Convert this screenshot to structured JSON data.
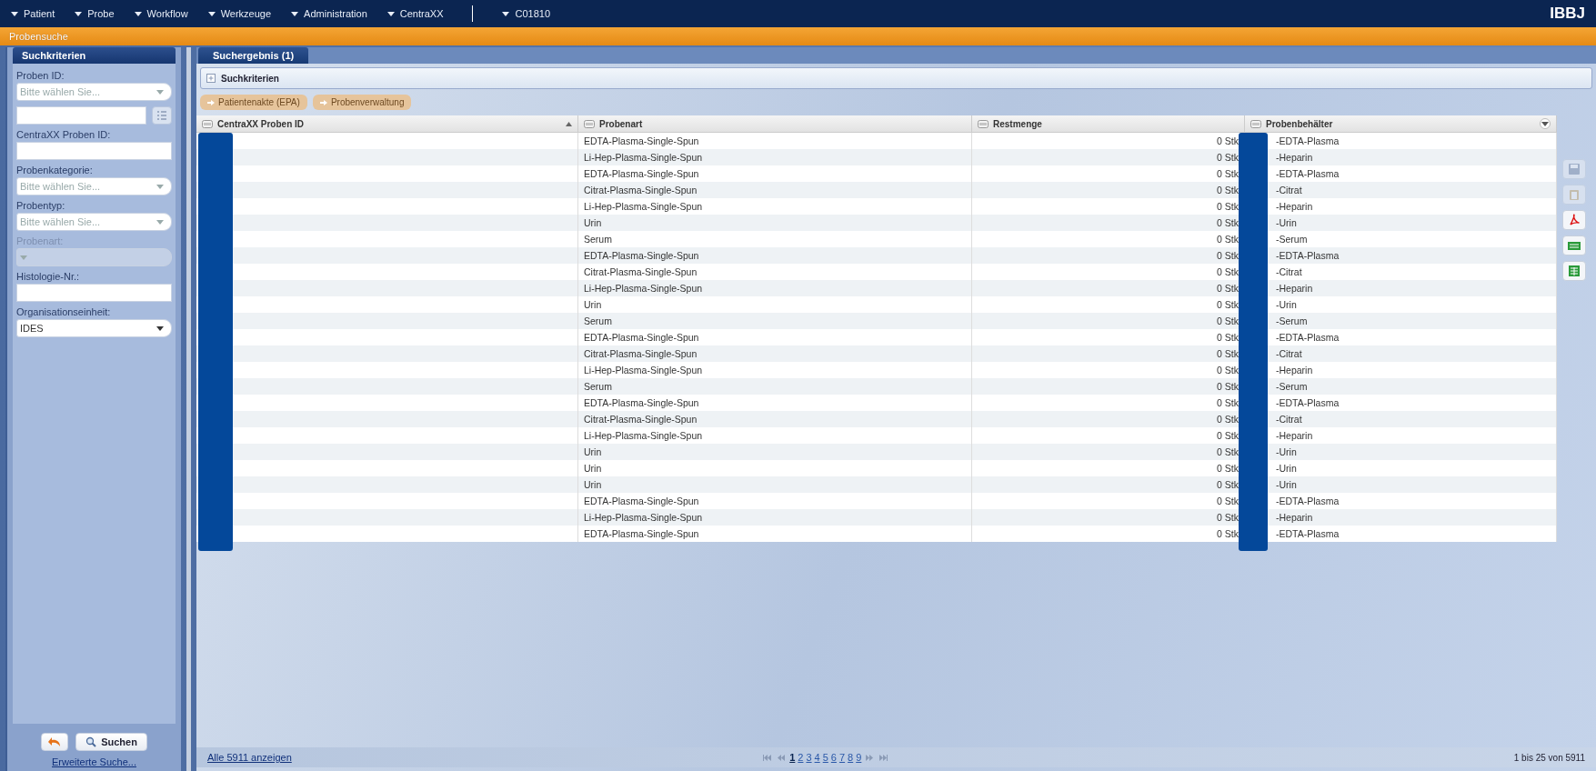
{
  "menu": [
    {
      "label": "Patient"
    },
    {
      "label": "Probe"
    },
    {
      "label": "Workflow"
    },
    {
      "label": "Werkzeuge"
    },
    {
      "label": "Administration"
    },
    {
      "label": "CentraXX"
    },
    {
      "label": "C01810"
    }
  ],
  "logo": "IBBJ",
  "page_title": "Probensuche",
  "sidebar": {
    "title": "Suchkriterien",
    "fields": [
      {
        "label": "Proben ID:",
        "kind": "select",
        "placeholder": "Bitte wählen Sie..."
      },
      {
        "kind": "text-list"
      },
      {
        "label": "CentraXX Proben ID:",
        "kind": "text"
      },
      {
        "label": "Probenkategorie:",
        "kind": "select",
        "placeholder": "Bitte wählen Sie..."
      },
      {
        "label": "Probentyp:",
        "kind": "select",
        "placeholder": "Bitte wählen Sie..."
      },
      {
        "label": "Probenart:",
        "kind": "select",
        "disabled": true
      },
      {
        "label": "Histologie-Nr.:",
        "kind": "text"
      },
      {
        "label": "Organisationseinheit:",
        "kind": "select",
        "value": "IDES"
      }
    ],
    "search_button": "Suchen",
    "advanced_link": "Erweiterte Suche..."
  },
  "tabs": [
    {
      "label": "Suchergebnis (1)",
      "selected": true
    }
  ],
  "criteria_panel": {
    "title": "Suchkriterien",
    "expanded": false
  },
  "actions": [
    {
      "label": "Patientenakte (EPA)",
      "disabled": true
    },
    {
      "label": "Probenverwaltung",
      "disabled": true
    }
  ],
  "table": {
    "columns": [
      {
        "label": "CentraXX Proben ID",
        "sorted": true
      },
      {
        "label": "Probenart",
        "sorted": false
      },
      {
        "label": "Restmenge",
        "sorted": false
      },
      {
        "label": "Probenbehälter",
        "sorted": false
      }
    ],
    "rows": [
      [
        "",
        "EDTA-Plasma-Single-Spun",
        "0 Stk",
        "-EDTA-Plasma"
      ],
      [
        "",
        "Li-Hep-Plasma-Single-Spun",
        "0 Stk",
        "-Heparin"
      ],
      [
        "",
        "EDTA-Plasma-Single-Spun",
        "0 Stk",
        "-EDTA-Plasma"
      ],
      [
        "",
        "Citrat-Plasma-Single-Spun",
        "0 Stk",
        "-Citrat"
      ],
      [
        "",
        "Li-Hep-Plasma-Single-Spun",
        "0 Stk",
        "-Heparin"
      ],
      [
        "",
        "Urin",
        "0 Stk",
        "-Urin"
      ],
      [
        "",
        "Serum",
        "0 Stk",
        "-Serum"
      ],
      [
        "",
        "EDTA-Plasma-Single-Spun",
        "0 Stk",
        "-EDTA-Plasma"
      ],
      [
        "",
        "Citrat-Plasma-Single-Spun",
        "0 Stk",
        "-Citrat"
      ],
      [
        "",
        "Li-Hep-Plasma-Single-Spun",
        "0 Stk",
        "-Heparin"
      ],
      [
        "",
        "Urin",
        "0 Stk",
        "-Urin"
      ],
      [
        "",
        "Serum",
        "0 Stk",
        "-Serum"
      ],
      [
        "",
        "EDTA-Plasma-Single-Spun",
        "0 Stk",
        "-EDTA-Plasma"
      ],
      [
        "",
        "Citrat-Plasma-Single-Spun",
        "0 Stk",
        "-Citrat"
      ],
      [
        "",
        "Li-Hep-Plasma-Single-Spun",
        "0 Stk",
        "-Heparin"
      ],
      [
        "",
        "Serum",
        "0 Stk",
        "-Serum"
      ],
      [
        "",
        "EDTA-Plasma-Single-Spun",
        "0 Stk",
        "-EDTA-Plasma"
      ],
      [
        "",
        "Citrat-Plasma-Single-Spun",
        "0 Stk",
        "-Citrat"
      ],
      [
        "",
        "Li-Hep-Plasma-Single-Spun",
        "0 Stk",
        "-Heparin"
      ],
      [
        "",
        "Urin",
        "0 Stk",
        "-Urin"
      ],
      [
        "",
        "Urin",
        "0 Stk",
        "-Urin"
      ],
      [
        "",
        "Urin",
        "0 Stk",
        "-Urin"
      ],
      [
        "",
        "EDTA-Plasma-Single-Spun",
        "0 Stk",
        "-EDTA-Plasma"
      ],
      [
        "",
        "Li-Hep-Plasma-Single-Spun",
        "0 Stk",
        "-Heparin"
      ],
      [
        "",
        "EDTA-Plasma-Single-Spun",
        "0 Stk",
        "-EDTA-Plasma"
      ]
    ]
  },
  "tools": [
    {
      "kind": "save",
      "disabled": true
    },
    {
      "kind": "clipboard",
      "disabled": true
    },
    {
      "kind": "pdf",
      "disabled": false
    },
    {
      "kind": "csv",
      "disabled": false
    },
    {
      "kind": "excel",
      "disabled": false
    }
  ],
  "footer": {
    "show_all_link": "Alle 5911 anzeigen",
    "pages": [
      {
        "label": "1",
        "selected": true
      },
      {
        "label": "2",
        "selected": false
      },
      {
        "label": "3",
        "selected": false
      },
      {
        "label": "4",
        "selected": false
      },
      {
        "label": "5",
        "selected": false
      },
      {
        "label": "6",
        "selected": false
      },
      {
        "label": "7",
        "selected": false
      },
      {
        "label": "8",
        "selected": false
      },
      {
        "label": "9",
        "selected": false
      }
    ],
    "range": "1 bis 25 von 5911"
  }
}
